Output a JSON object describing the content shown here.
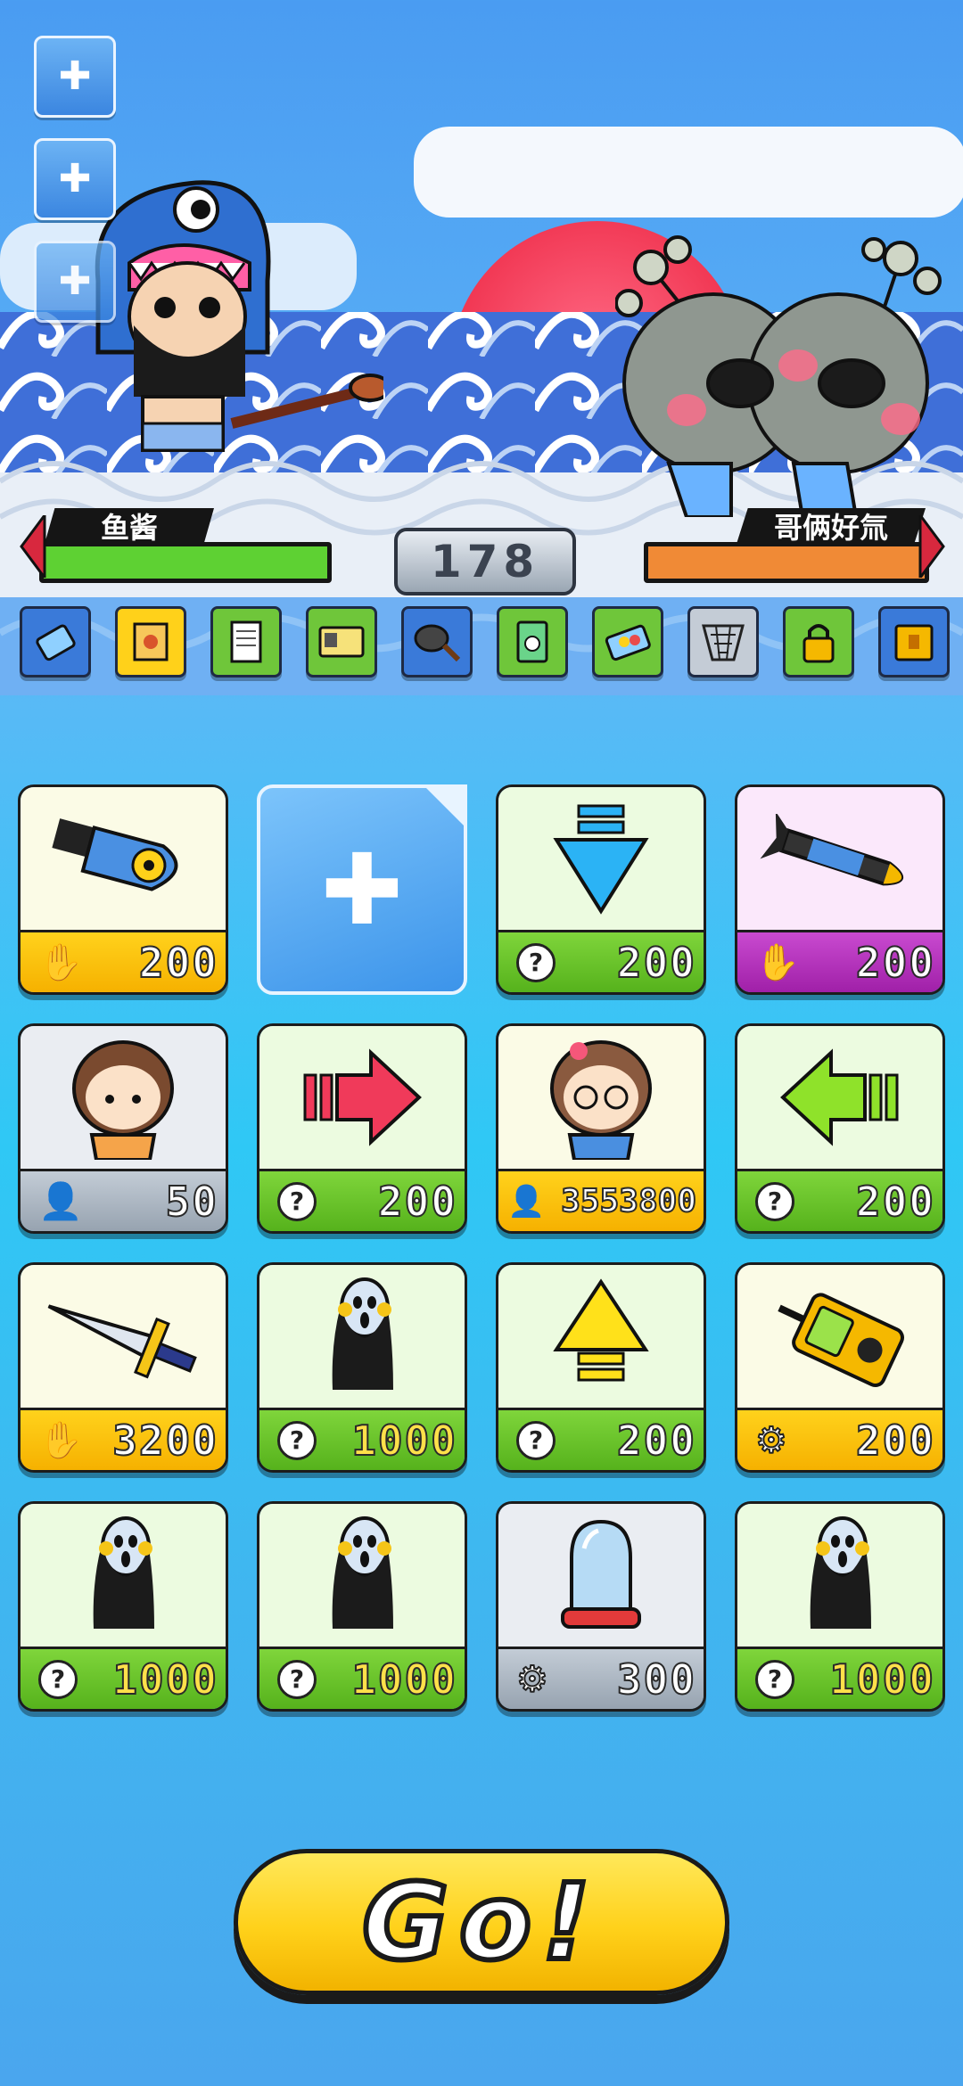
{
  "battle": {
    "player_name": "鱼酱",
    "enemy_name": "哥俩好氚",
    "score": "178",
    "player_hp_color": "#5ed133",
    "enemy_hp_color": "#f08a36"
  },
  "side_buttons": [
    "add-slot-1",
    "add-slot-2",
    "add-slot-3"
  ],
  "tools": [
    "battery",
    "lucky-scroll",
    "document",
    "id-card",
    "frying-pan",
    "radio-card",
    "pills",
    "net",
    "padlock",
    "treasure-box"
  ],
  "cards": [
    {
      "item": "nuclear-bomb",
      "cost": "200",
      "currency": "hand",
      "footer": "yellow",
      "bg": "cream"
    },
    {
      "item": "empty-slot"
    },
    {
      "item": "blue-down-arrow",
      "cost": "200",
      "currency": "question",
      "footer": "green",
      "bg": "mint"
    },
    {
      "item": "missile",
      "cost": "200",
      "currency": "hand",
      "footer": "purple",
      "bg": "pink"
    },
    {
      "item": "girl-orange",
      "cost": "50",
      "currency": "person",
      "footer": "gray",
      "bg": "silver"
    },
    {
      "item": "red-right-arrow",
      "cost": "200",
      "currency": "question",
      "footer": "green",
      "bg": "mint"
    },
    {
      "item": "girl-glasses",
      "cost": "3553800",
      "currency": "person",
      "footer": "yellow",
      "bg": "cream"
    },
    {
      "item": "green-left-arrow",
      "cost": "200",
      "currency": "question",
      "footer": "green",
      "bg": "mint"
    },
    {
      "item": "sword",
      "cost": "3200",
      "currency": "hand",
      "footer": "yellow",
      "bg": "cream"
    },
    {
      "item": "scream-figure",
      "cost": "1000",
      "currency": "question",
      "footer": "green",
      "bg": "mint"
    },
    {
      "item": "yellow-up-arrow",
      "cost": "200",
      "currency": "question",
      "footer": "green",
      "bg": "mint"
    },
    {
      "item": "radiation-radio",
      "cost": "200",
      "currency": "chip",
      "footer": "yellow",
      "bg": "cream"
    },
    {
      "item": "scream-figure",
      "cost": "1000",
      "currency": "question",
      "footer": "green",
      "bg": "mint"
    },
    {
      "item": "scream-figure",
      "cost": "1000",
      "currency": "question",
      "footer": "green",
      "bg": "mint"
    },
    {
      "item": "glass-dome",
      "cost": "300",
      "currency": "chip",
      "footer": "gray",
      "bg": "silver"
    },
    {
      "item": "scream-figure",
      "cost": "1000",
      "currency": "question",
      "footer": "green",
      "bg": "mint"
    }
  ],
  "go_button": "Go!"
}
